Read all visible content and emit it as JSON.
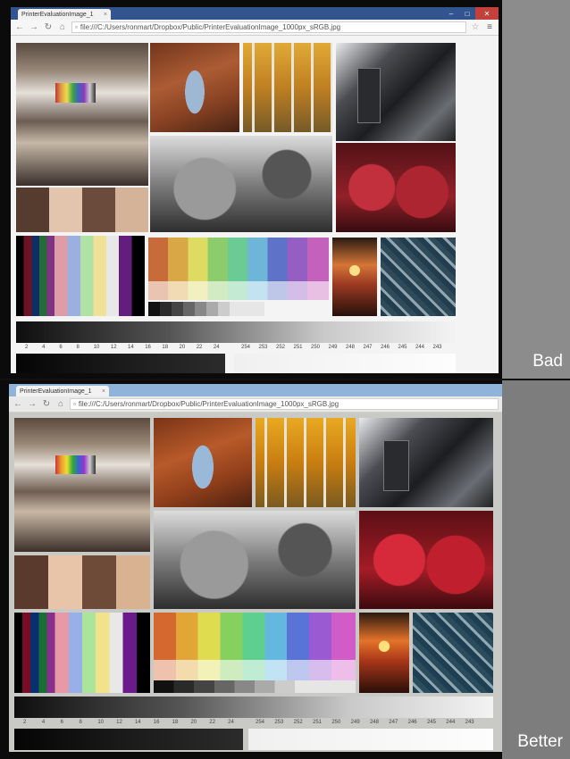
{
  "panels": [
    {
      "label": "Bad",
      "tab_title": "PrinterEvaluationImage_1",
      "url": "file:///C:/Users/ronmart/Dropbox/Public/PrinterEvaluationImage_1000px_sRGB.jpg",
      "scale_low": [
        "2",
        "4",
        "6",
        "8",
        "10",
        "12",
        "14",
        "16",
        "18",
        "20",
        "22",
        "24"
      ],
      "scale_high": [
        "254",
        "253",
        "252",
        "251",
        "250",
        "249",
        "248",
        "247",
        "246",
        "245",
        "244",
        "243"
      ]
    },
    {
      "label": "Better",
      "tab_title": "PrinterEvaluationImage_1",
      "url": "file:///C:/Users/ronmart/Dropbox/Public/PrinterEvaluationImage_1000px_sRGB.jpg",
      "scale_low": [
        "2",
        "4",
        "6",
        "8",
        "10",
        "12",
        "14",
        "16",
        "18",
        "20",
        "22",
        "24"
      ],
      "scale_high": [
        "254",
        "253",
        "252",
        "251",
        "250",
        "249",
        "248",
        "247",
        "246",
        "245",
        "244",
        "243"
      ]
    }
  ],
  "icons": {
    "back": "arrow-left-icon",
    "forward": "arrow-right-icon",
    "reload": "reload-icon",
    "home": "home-icon",
    "page": "page-icon",
    "star": "star-icon",
    "menu": "hamburger-menu-icon",
    "close": "close-icon"
  }
}
